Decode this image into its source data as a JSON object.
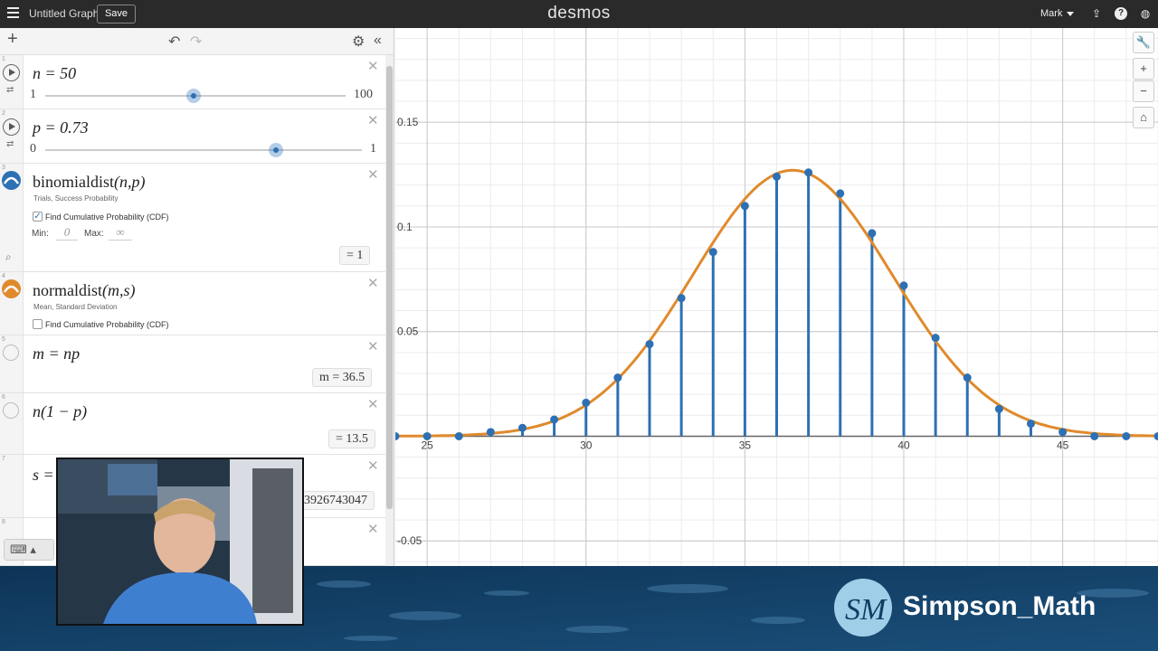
{
  "topbar": {
    "title": "Untitled Graph",
    "save_label": "Save",
    "brand": "desmos",
    "user": "Mark"
  },
  "expressions": [
    {
      "num": "1",
      "latex": "n = 50",
      "slider": {
        "min": "1",
        "max": "100",
        "value": 50
      }
    },
    {
      "num": "2",
      "latex": "p = 0.73",
      "slider": {
        "min": "0",
        "max": "1",
        "value": 0.73
      }
    },
    {
      "num": "3",
      "name": "binomialdist",
      "args": "(n,p)",
      "params": "Trials, Success Probability",
      "cdf_label": "Find Cumulative Probability (CDF)",
      "cdf_checked": true,
      "min_label": "Min:",
      "min_value": "0",
      "max_label": "Max:",
      "max_value": "∞",
      "result": "= 1"
    },
    {
      "num": "4",
      "name": "normaldist",
      "args": "(m,s)",
      "params": "Mean, Standard Deviation",
      "cdf_label": "Find Cumulative Probability (CDF)",
      "cdf_checked": false
    },
    {
      "num": "5",
      "latex": "m = np",
      "result": "m  =  36.5"
    },
    {
      "num": "6",
      "latex": "n(1 − p)",
      "result": "=  13.5"
    },
    {
      "num": "7",
      "latex": "s =",
      "result": "3926743047"
    },
    {
      "num": "8"
    }
  ],
  "graph": {
    "x_ticks": [
      "25",
      "30",
      "35",
      "40",
      "45"
    ],
    "y_ticks": [
      "0.15",
      "0.1",
      "0.05",
      "-0.05"
    ],
    "x_range": [
      24,
      48
    ],
    "y_range": [
      -0.062,
      0.195
    ],
    "binomial_color": "#2d70b3",
    "normal_color": "#e08a2c"
  },
  "chart_data": {
    "type": "scatter",
    "series": [
      {
        "x": [
          24,
          25,
          26,
          27,
          28,
          29,
          30,
          31,
          32,
          33,
          34,
          35,
          36,
          37,
          38,
          39,
          40,
          41,
          42,
          43,
          44,
          45,
          46,
          47,
          48
        ],
        "y": [
          0,
          0,
          0,
          0.002,
          0.004,
          0.008,
          0.016,
          0.028,
          0.044,
          0.066,
          0.088,
          0.11,
          0.124,
          0.126,
          0.116,
          0.097,
          0.072,
          0.047,
          0.028,
          0.013,
          0.006,
          0.002,
          0,
          0,
          0
        ]
      }
    ],
    "normal_mean": 36.5,
    "normal_sd": 3.14
  },
  "banner": {
    "brand": "Simpson_Math"
  }
}
